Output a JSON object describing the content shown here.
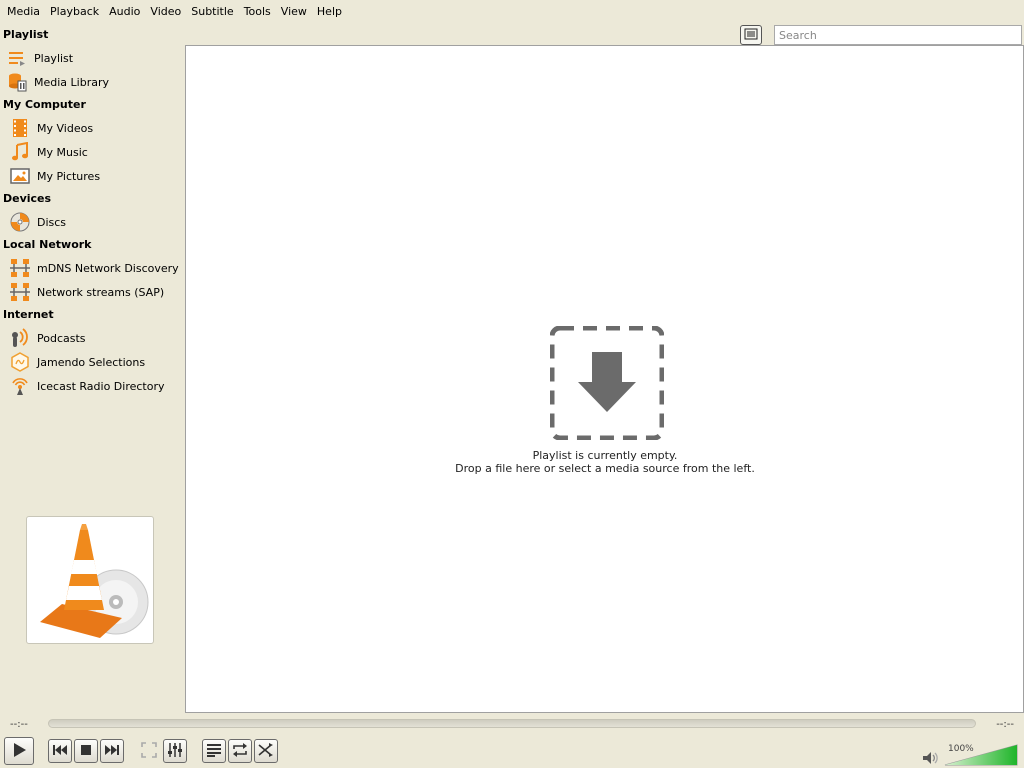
{
  "menu": [
    "Media",
    "Playback",
    "Audio",
    "Video",
    "Subtitle",
    "Tools",
    "View",
    "Help"
  ],
  "sidebar": {
    "sections": [
      {
        "title": "Playlist",
        "items": [
          {
            "label": "Playlist",
            "icon": "playlist-icon"
          },
          {
            "label": "Media Library",
            "icon": "media-library-icon"
          }
        ]
      },
      {
        "title": "My Computer",
        "items": [
          {
            "label": "My Videos",
            "icon": "film-icon"
          },
          {
            "label": "My Music",
            "icon": "music-note-icon"
          },
          {
            "label": "My Pictures",
            "icon": "picture-icon"
          }
        ]
      },
      {
        "title": "Devices",
        "items": [
          {
            "label": "Discs",
            "icon": "disc-icon"
          }
        ]
      },
      {
        "title": "Local Network",
        "items": [
          {
            "label": "mDNS Network Discovery",
            "icon": "network-icon"
          },
          {
            "label": "Network streams (SAP)",
            "icon": "network-icon"
          }
        ]
      },
      {
        "title": "Internet",
        "items": [
          {
            "label": "Podcasts",
            "icon": "podcast-icon"
          },
          {
            "label": "Jamendo Selections",
            "icon": "jamendo-icon"
          },
          {
            "label": "Icecast Radio Directory",
            "icon": "radio-icon"
          }
        ]
      }
    ]
  },
  "search": {
    "placeholder": "Search",
    "value": ""
  },
  "playlist": {
    "empty_line1": "Playlist is currently empty.",
    "empty_line2": "Drop a file here or select a media source from the left."
  },
  "seek": {
    "elapsed": "--:--",
    "remaining": "--:--"
  },
  "volume": {
    "label": "100%",
    "level": 1.0
  },
  "colors": {
    "accent": "#f08a1c",
    "volume_green": "#2fbf3a",
    "background": "#ece9d8"
  }
}
